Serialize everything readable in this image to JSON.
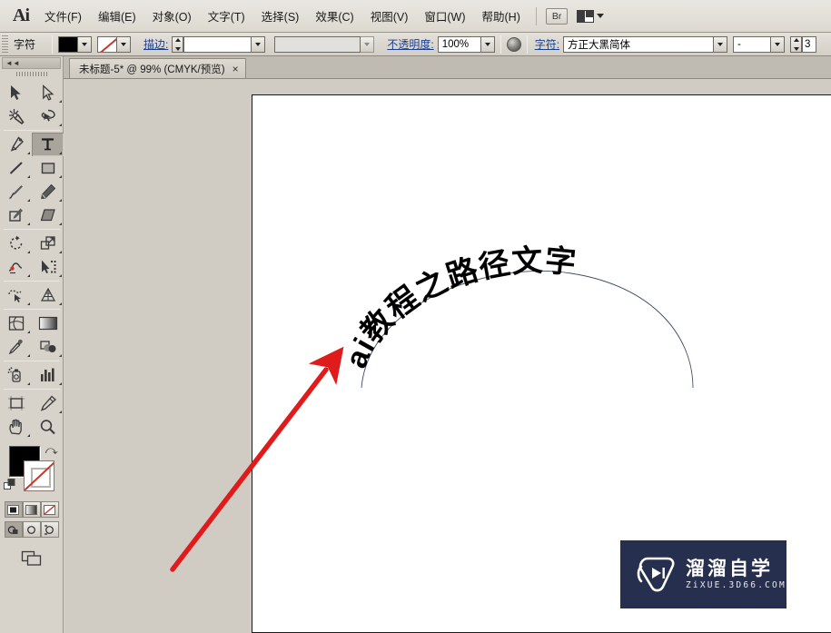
{
  "app": {
    "name": "Ai",
    "logo_text": "Ai"
  },
  "menubar": {
    "items": [
      {
        "label": "文件(F)",
        "name": "menu-file"
      },
      {
        "label": "编辑(E)",
        "name": "menu-edit"
      },
      {
        "label": "对象(O)",
        "name": "menu-object"
      },
      {
        "label": "文字(T)",
        "name": "menu-type"
      },
      {
        "label": "选择(S)",
        "name": "menu-select"
      },
      {
        "label": "效果(C)",
        "name": "menu-effect"
      },
      {
        "label": "视图(V)",
        "name": "menu-view"
      },
      {
        "label": "窗口(W)",
        "name": "menu-window"
      },
      {
        "label": "帮助(H)",
        "name": "menu-help"
      }
    ],
    "bridge_label": "Br"
  },
  "controlbar": {
    "panel_label": "字符",
    "stroke_label": "描边:",
    "stroke_weight": "",
    "stroke_profile": "",
    "opacity_label": "不透明度:",
    "opacity_value": "100%",
    "char_label": "字符:",
    "font_family": "方正大黑简体",
    "font_style": "-",
    "font_size": "3"
  },
  "tabbar": {
    "tab_title": "未标题-5* @ 99% (CMYK/预览)",
    "close_glyph": "×"
  },
  "toolbox": {
    "collapse_glyph": "◄◄",
    "tools": [
      {
        "name": "selection-tool",
        "label": "选择工具",
        "selected": false
      },
      {
        "name": "direct-selection-tool",
        "label": "直接选择工具",
        "selected": false
      },
      {
        "name": "magic-wand-tool",
        "label": "魔棒工具",
        "selected": false
      },
      {
        "name": "lasso-tool",
        "label": "套索工具",
        "selected": false
      },
      {
        "name": "pen-tool",
        "label": "钢笔工具",
        "selected": false
      },
      {
        "name": "type-tool",
        "label": "文字工具",
        "selected": true
      },
      {
        "name": "line-segment-tool",
        "label": "直线段工具",
        "selected": false
      },
      {
        "name": "rectangle-tool",
        "label": "矩形工具",
        "selected": false
      },
      {
        "name": "paintbrush-tool",
        "label": "画笔工具",
        "selected": false
      },
      {
        "name": "pencil-tool",
        "label": "铅笔工具",
        "selected": false
      },
      {
        "name": "blob-brush-tool",
        "label": "斑点画笔工具",
        "selected": false
      },
      {
        "name": "eraser-tool",
        "label": "橡皮擦工具",
        "selected": false
      },
      {
        "name": "rotate-tool",
        "label": "旋转工具",
        "selected": false
      },
      {
        "name": "scale-tool",
        "label": "比例缩放工具",
        "selected": false
      },
      {
        "name": "width-tool",
        "label": "宽度工具",
        "selected": false
      },
      {
        "name": "free-transform-tool",
        "label": "自由变换工具",
        "selected": false
      },
      {
        "name": "shape-builder-tool",
        "label": "形状生成器工具",
        "selected": false
      },
      {
        "name": "perspective-grid-tool",
        "label": "透视网格工具",
        "selected": false
      },
      {
        "name": "mesh-tool",
        "label": "网格工具",
        "selected": false
      },
      {
        "name": "gradient-tool",
        "label": "渐变工具",
        "selected": false
      },
      {
        "name": "eyedropper-tool",
        "label": "吸管工具",
        "selected": false
      },
      {
        "name": "blend-tool",
        "label": "混合工具",
        "selected": false
      },
      {
        "name": "symbol-sprayer-tool",
        "label": "符号喷枪工具",
        "selected": false
      },
      {
        "name": "column-graph-tool",
        "label": "柱形图工具",
        "selected": false
      },
      {
        "name": "artboard-tool",
        "label": "画板工具",
        "selected": false
      },
      {
        "name": "slice-tool",
        "label": "切片工具",
        "selected": false
      },
      {
        "name": "hand-tool",
        "label": "抓手工具",
        "selected": false
      },
      {
        "name": "zoom-tool",
        "label": "缩放工具",
        "selected": false
      }
    ],
    "fill_color": "#000000",
    "stroke_color": "none",
    "swap_glyph": "⤺",
    "color_modes": [
      {
        "name": "color-mode-button",
        "selected": true
      },
      {
        "name": "gradient-mode-button",
        "selected": false
      },
      {
        "name": "none-mode-button",
        "selected": false
      }
    ],
    "draw_modes": [
      {
        "name": "draw-normal-button",
        "selected": true
      },
      {
        "name": "draw-behind-button",
        "selected": false
      },
      {
        "name": "draw-inside-button",
        "selected": false
      }
    ]
  },
  "canvas": {
    "path_text": "ai教程之路径文字",
    "path_text_color": "#000000",
    "path_stroke_color": "#3b4a63",
    "annotation_arrow_color": "#e01b1b",
    "artboard_color": "#ffffff",
    "background_color": "#d0ccc4"
  },
  "watermark": {
    "title": "溜溜自学",
    "subtitle": "ZiXUE.3D66.COM",
    "bg_color": "#272f4e",
    "fg_color": "#ffffff"
  }
}
